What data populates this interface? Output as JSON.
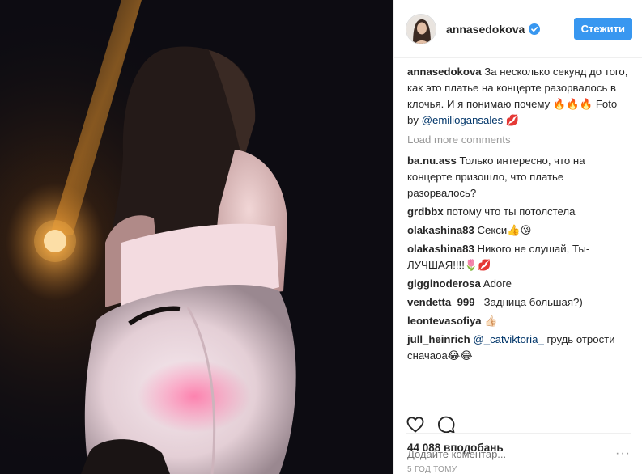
{
  "header": {
    "username": "annasedokova",
    "follow_label": "Стежити"
  },
  "caption": {
    "author": "annasedokova",
    "text": "За несколько секунд до того, как это платье на концерте разорвалось в клочья. И я понимаю почему 🔥🔥🔥 Foto by ",
    "mention": "@emiliogansales",
    "suffix": " 💋"
  },
  "load_more": "Load more comments",
  "comments": [
    {
      "user": "ba.nu.ass",
      "text": "Только интересно, что на концерте призошло, что платье разорвалось?"
    },
    {
      "user": "grdbbx",
      "text": "потому что ты потолстела"
    },
    {
      "user": "olakashina83",
      "text": "Секси👍😘"
    },
    {
      "user": "olakashina83",
      "text": "Никого не слушай, Ты- ЛУЧШАЯ!!!!🌷💋"
    },
    {
      "user": "gigginoderosa",
      "text": "Adore"
    },
    {
      "user": "vendetta_999_",
      "text": "Задница большая?)"
    },
    {
      "user": "leontevasofiya",
      "text": "👍🏻"
    },
    {
      "user": "jull_heinrich",
      "mention": "@_catviktoria_",
      "text": " грудь отрости сначаоа😂😂"
    }
  ],
  "likes": "44 088 вподобань",
  "time": "5 год тому",
  "add_comment": {
    "placeholder": "Додайте коментар..."
  },
  "more_label": "···",
  "icons": {
    "like": "heart-icon",
    "comment": "comment-icon",
    "verified": "verified-badge-icon",
    "more": "more-options-icon"
  },
  "colors": {
    "accent": "#3897f0",
    "mention": "#003569",
    "muted": "#999999",
    "border": "#efefef"
  }
}
